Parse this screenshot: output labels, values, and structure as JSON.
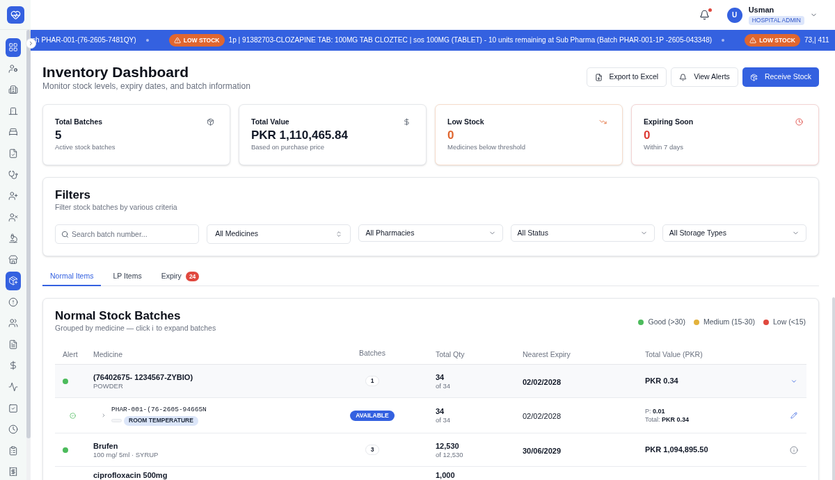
{
  "sidebar": {
    "items": [
      {
        "selected": true
      },
      {
        "selected": false
      },
      {
        "selected": false
      },
      {
        "selected": false
      },
      {
        "selected": false
      },
      {
        "selected": false
      },
      {
        "selected": false
      },
      {
        "selected": false
      },
      {
        "selected": false
      },
      {
        "selected": false
      },
      {
        "selected": false
      },
      {
        "selected": true
      },
      {
        "selected": false
      },
      {
        "selected": false
      },
      {
        "selected": false
      },
      {
        "selected": false
      },
      {
        "selected": false
      },
      {
        "selected": false
      },
      {
        "selected": false
      },
      {
        "selected": false
      },
      {
        "selected": false
      }
    ]
  },
  "header": {
    "notifications": {
      "unread": true
    },
    "user": {
      "initial": "U",
      "name": "Usman",
      "role": "HOSPITAL ADMIN"
    }
  },
  "ticker": {
    "segments": [
      {
        "text": "ch PHAR-001-(76-2605-7481QY)"
      },
      {
        "badge": "LOW STOCK",
        "text": "1p | 91382703-CLOZAPINE TAB: 100MG TAB CLOZTEC | sos 100MG (TABLET) - 10 units remaining at Sub Pharma (Batch PHAR-001-1P -2605-043348)"
      },
      {
        "badge": "LOW STOCK",
        "text": "73,| 411"
      }
    ]
  },
  "page": {
    "title": "Inventory Dashboard",
    "subtitle": "Monitor stock levels, expiry dates, and batch information",
    "actions": [
      {
        "label": "Export to Excel",
        "kind": "outline"
      },
      {
        "label": "View Alerts",
        "kind": "outline"
      },
      {
        "label": "Receive Stock",
        "kind": "primary"
      }
    ]
  },
  "stats": [
    {
      "label": "Total Batches",
      "value": "5",
      "note": "Active stock batches",
      "kind": "default"
    },
    {
      "label": "Total Value",
      "value": "PKR 1,110,465.84",
      "note": "Based on purchase price",
      "kind": "default"
    },
    {
      "label": "Low Stock",
      "value": "0",
      "note": "Medicines below threshold",
      "kind": "warning"
    },
    {
      "label": "Expiring Soon",
      "value": "0",
      "note": "Within 7 days",
      "kind": "danger"
    }
  ],
  "filters": {
    "title": "Filters",
    "subtitle": "Filter stock batches by various criteria",
    "fields": [
      {
        "kind": "search",
        "placeholder": "Search batch number..."
      },
      {
        "kind": "combobox",
        "value": "All Medicines"
      },
      {
        "kind": "select",
        "value": "All Pharmacies"
      },
      {
        "kind": "select",
        "value": "All Status"
      },
      {
        "kind": "select",
        "value": "All Storage Types"
      }
    ]
  },
  "tabs": [
    {
      "label": "Normal Items",
      "selected": true
    },
    {
      "label": "LP Items",
      "selected": false
    },
    {
      "label": "Expiry",
      "selected": false,
      "badge": "24"
    }
  ],
  "table": {
    "title": "Normal Stock Batches",
    "subtitle": "Grouped by medicine — click ℹ to expand batches",
    "legend": [
      {
        "label": "Good (>30)",
        "color": "#4cbb5c"
      },
      {
        "label": "Medium (15-30)",
        "color": "#e3b23c"
      },
      {
        "label": "Low (<15)",
        "color": "#e0483e"
      }
    ],
    "columns": [
      "Alert",
      "Medicine",
      "Batches",
      "Total Qty",
      "Nearest Expiry",
      "Total Value (PKR)"
    ],
    "rows": [
      {
        "kind": "medicine",
        "color": "#4cbb5c",
        "name": "(76402675- 1234567-ZYBIO)",
        "detail": "POWDER",
        "batches": "1",
        "qty": "34",
        "qty_total": "of 34",
        "expiry": "02/02/2028",
        "value": "PKR 0.34",
        "expanded": true
      },
      {
        "kind": "batch",
        "batch_number": "PHAR-001-(76-2605-94665N",
        "storage": "ROOM TEMPERATURE",
        "status": "AVAILABLE",
        "qty": "34",
        "qty_total": "of 34",
        "expiry": "02/02/2028",
        "unit_price": "P: **0.01**",
        "line_total": "Total: **PKR 0.34**"
      },
      {
        "kind": "medicine",
        "color": "#4cbb5c",
        "name": "Brufen",
        "detail": "100 mg/ 5ml · SYRUP",
        "batches": "3",
        "qty": "12,530",
        "qty_total": "of 12,530",
        "expiry": "30/06/2029",
        "value": "PKR 1,094,895.50",
        "expanded": false
      },
      {
        "kind": "medicine",
        "name": "ciprofloxacin 500mg",
        "qty": "1,000"
      }
    ]
  }
}
